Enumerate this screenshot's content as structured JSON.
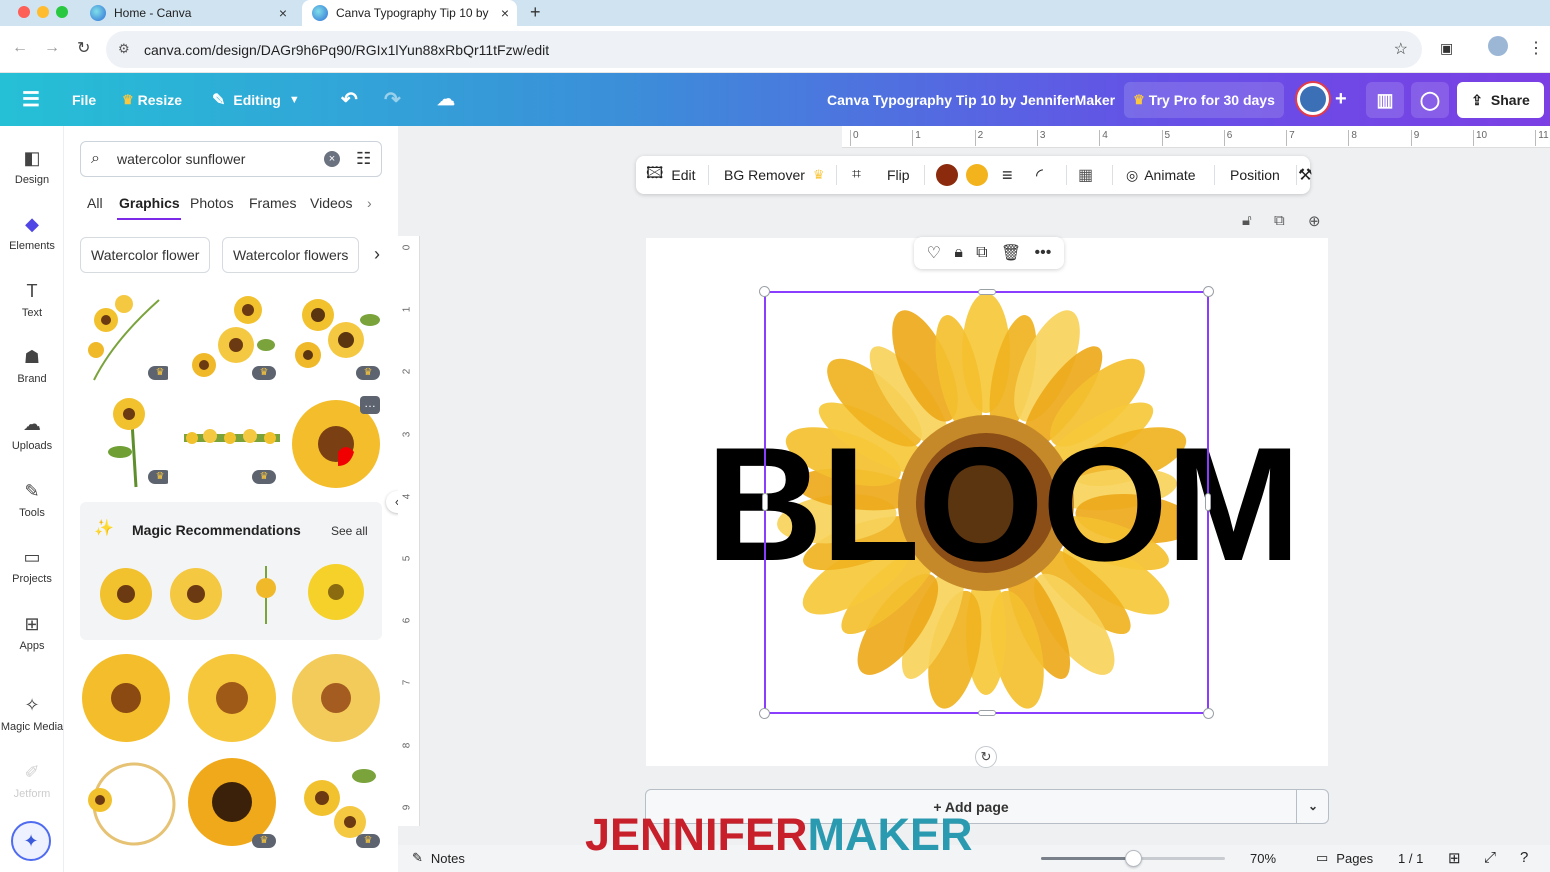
{
  "browser": {
    "tabs": [
      {
        "label": "Home - Canva"
      },
      {
        "label": "Canva Typography Tip 10 by"
      }
    ],
    "url": "canva.com/design/DAGr9h6Pq90/RGIx1lYun88xRbQr11tFzw/edit",
    "new_tab": "+",
    "tab_close": "×"
  },
  "header": {
    "file": "File",
    "resize": "Resize",
    "editing": "Editing",
    "doc_title": "Canva Typography Tip 10 by JenniferMaker",
    "try_pro": "Try Pro for 30 days",
    "share": "Share",
    "plus": "+"
  },
  "rail": [
    {
      "label": "Design",
      "icon": "design-icon"
    },
    {
      "label": "Elements",
      "icon": "elements-icon"
    },
    {
      "label": "Text",
      "icon": "text-icon"
    },
    {
      "label": "Brand",
      "icon": "brand-icon"
    },
    {
      "label": "Uploads",
      "icon": "uploads-icon"
    },
    {
      "label": "Tools",
      "icon": "tools-icon"
    },
    {
      "label": "Projects",
      "icon": "projects-icon"
    },
    {
      "label": "Apps",
      "icon": "apps-icon"
    },
    {
      "label": "Magic Media",
      "icon": "magic-media-icon"
    },
    {
      "label": "Jetform",
      "icon": "jetform-icon"
    }
  ],
  "panel": {
    "search_value": "watercolor sunflower",
    "categories": [
      "All",
      "Graphics",
      "Photos",
      "Frames",
      "Videos"
    ],
    "active_category": "Graphics",
    "chips": [
      "Watercolor flower",
      "Watercolor flowers"
    ],
    "magic_title": "Magic Recommendations",
    "see_all": "See all"
  },
  "context_toolbar": {
    "edit": "Edit",
    "bg_remover": "BG Remover",
    "flip": "Flip",
    "animate": "Animate",
    "position": "Position",
    "swatch1": "#8b2a0c",
    "swatch2": "#f2b31d"
  },
  "canvas": {
    "text": "BLOOM",
    "add_page": "+ Add page",
    "selection_color": "#8b3dff"
  },
  "rulers": {
    "top": [
      "0",
      "1",
      "2",
      "3",
      "4",
      "5",
      "6",
      "7",
      "8",
      "9",
      "10",
      "11"
    ],
    "left": [
      "0",
      "1",
      "2",
      "3",
      "4",
      "5",
      "6",
      "7",
      "8",
      "9"
    ]
  },
  "footer": {
    "notes": "Notes",
    "zoom": "70%",
    "zoom_level": 0.7,
    "pages": "Pages",
    "page_count": "1 / 1"
  },
  "watermark": {
    "part1": "JENNIFER",
    "part2": "MAKER",
    "color1": "#c8202b",
    "color2": "#2a9ab1"
  }
}
